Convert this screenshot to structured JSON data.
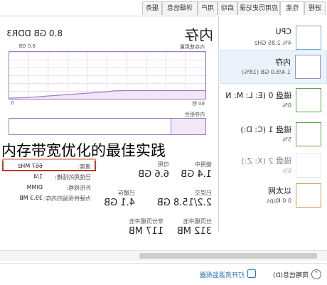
{
  "tabs": [
    "进程",
    "性能",
    "应用历史记录",
    "启动",
    "用户",
    "详细信息",
    "服务"
  ],
  "sidebar": [
    {
      "name": "CPU",
      "detail": "4% 2.85 GHz"
    },
    {
      "name": "内存",
      "detail": "1.4/8.0 GB (18%)"
    },
    {
      "name": "磁盘 0 (E: L: M: N",
      "detail": "0%"
    },
    {
      "name": "磁盘 1 (C: D:)",
      "detail": "5%"
    },
    {
      "name": "磁盘 2 (X: Z:)",
      "detail": "0%"
    },
    {
      "name": "以太网",
      "detail": "0 0 Kbps"
    }
  ],
  "main": {
    "title": "内存",
    "capacity": "8.0 GB DDR3",
    "usage_label": "内存使用量",
    "usage_max": "8.0 GB",
    "seconds_label": "60 秒",
    "zero": "0",
    "composition_label": "内存组合"
  },
  "stats": {
    "in_use_label": "使用中",
    "in_use_value": "1.4 GB",
    "available_label": "可用",
    "available_value": "6.6 GB",
    "committed_label": "已提交",
    "committed_value": "2.2/15.8 GB",
    "cached_label": "已缓存",
    "cached_value": "4.1 GB",
    "paged_pool_label": "分页缓冲池",
    "paged_pool_value": "312 MB",
    "nonpaged_pool_label": "非分页缓冲池",
    "nonpaged_pool_value": "117 MB"
  },
  "details": {
    "speed_label": "速度:",
    "speed_value": "667 MHz",
    "slots_label": "已使用的插槽:",
    "slots_value": "1/4",
    "form_factor_label": "外形规格:",
    "form_factor_value": "DIMM",
    "reserved_label": "为硬件保留的内存:",
    "reserved_value": "39.3 MB"
  },
  "footer": {
    "brief": "简略信息(D)",
    "resmon": "打开资源监视器"
  },
  "overlay_caption": "内存带宽优化的最佳实践",
  "chart_data": {
    "type": "area",
    "title": "内存使用量",
    "xlabel": "60 秒",
    "ylabel": "",
    "ylim": [
      0,
      8.0
    ],
    "x": [
      60,
      55,
      50,
      45,
      40,
      35,
      32,
      30,
      25,
      20,
      15,
      10,
      5,
      0
    ],
    "values": [
      1.4,
      1.4,
      1.4,
      1.4,
      1.4,
      1.4,
      1.35,
      1.2,
      1.0,
      0.8,
      0.6,
      0.4,
      0.2,
      0.1
    ],
    "unit": "GB"
  },
  "colors": {
    "accent": "#9c7cbe",
    "selected_bg": "#eaf3fb",
    "highlight_frame": "#c0392b"
  },
  "icons": [
    "chevron-up-icon",
    "resource-monitor-icon",
    "cpu-thumbnail",
    "memory-thumbnail",
    "disk-thumbnail",
    "ethernet-thumbnail"
  ]
}
